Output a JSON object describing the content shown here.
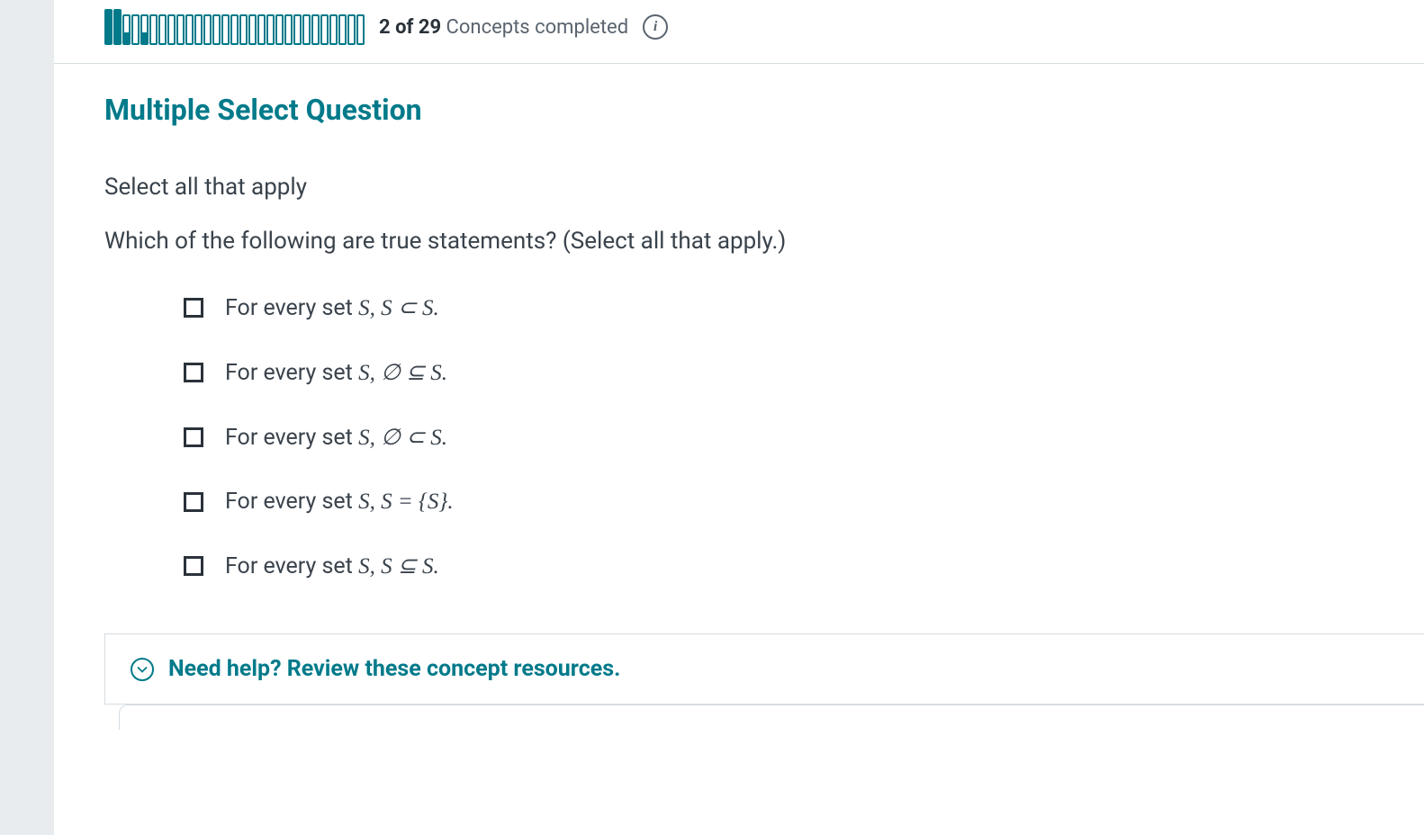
{
  "progress": {
    "total_segments": 29,
    "filled_segments": 2,
    "partial_segments": [
      2,
      4
    ],
    "text_prefix": "2 of 29",
    "text_suffix": " Concepts completed"
  },
  "question": {
    "type_label": "Multiple Select Question",
    "instruction": "Select all that apply",
    "prompt": "Which of the following are true statements? (Select all that apply.)",
    "options": [
      {
        "prefix": "For every set ",
        "math": "S, S ⊂ S."
      },
      {
        "prefix": "For every set ",
        "math": "S, ∅ ⊆ S."
      },
      {
        "prefix": "For every set ",
        "math": "S, ∅ ⊂ S."
      },
      {
        "prefix": "For every set ",
        "math": "S, S =  {S}."
      },
      {
        "prefix": "For every set ",
        "math": "S, S ⊆ S."
      }
    ]
  },
  "help": {
    "label": "Need help? Review these concept resources."
  }
}
